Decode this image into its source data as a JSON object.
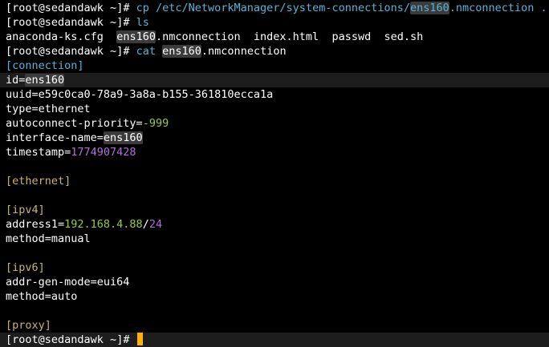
{
  "colors": {
    "background": "#000000",
    "text": "#ffffff",
    "command": "#57b4d8",
    "section_header": "#c8b46a",
    "number": "#98c84a",
    "timestamp": "#b070d8",
    "cursor": "#ffb000",
    "search_highlight": "#3b3b3b",
    "line_highlight": "#1d1d1d"
  },
  "prompt": {
    "open_bracket": "[",
    "user_host": "root@sedandawk ~",
    "close_bracket": "]",
    "symbol": "#"
  },
  "commands": {
    "cp": {
      "cmd": "cp",
      "arg_prefix": " /etc/NetworkManager/system-connections/",
      "arg_match": "ens160",
      "arg_suffix": ".nmconnection ."
    },
    "ls": {
      "cmd": "ls"
    },
    "cat": {
      "cmd": "cat",
      "arg_match": "ens160",
      "arg_suffix": ".nmconnection"
    }
  },
  "ls_output": {
    "file1": "anaconda-ks.cfg",
    "file2_match": "ens160",
    "file2_suffix": ".nmconnection",
    "file3": "index.html",
    "file4": "passwd",
    "file5": "sed.sh"
  },
  "file_contents": {
    "connection_header": "[connection]",
    "id_key": "id=",
    "id_value": "ens160",
    "uuid_line": "uuid=e59c0ca0-78a9-3a8a-b155-361810ecca1a",
    "type_line": "type=ethernet",
    "autoconnect_key": "autoconnect-priority=",
    "autoconnect_value": "-999",
    "interface_key": "interface-name=",
    "interface_value": "ens160",
    "timestamp_key": "timestamp=",
    "timestamp_value": "1774907428",
    "ethernet_header": "[ethernet]",
    "ipv4_header": "[ipv4]",
    "address_key": "address1=",
    "address_ip": "192.168.4.88",
    "address_slash": "/",
    "address_prefix": "24",
    "ipv4_method_line": "method=manual",
    "ipv6_header": "[ipv6]",
    "addr_gen_mode_line": "addr-gen-mode=eui64",
    "ipv6_method_line": "method=auto",
    "proxy_header": "[proxy]"
  }
}
